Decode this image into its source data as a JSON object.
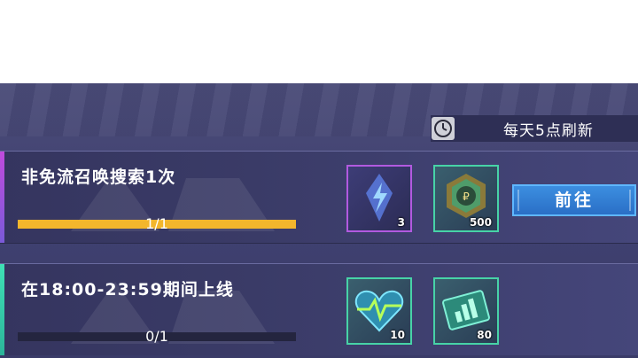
{
  "refresh": {
    "label": "每天5点刷新",
    "icon": "clock-icon"
  },
  "tasks": [
    {
      "title": "非免流召唤搜索1次",
      "progress_text": "1/1",
      "progress": 1.0,
      "accent": "#c04bdc",
      "rewards": [
        {
          "icon": "lightning-crystal-icon",
          "count": "3",
          "rarity_color": "#b25ae0"
        },
        {
          "icon": "coin-token-icon",
          "count": "500",
          "rarity_color": "#47d3a7"
        }
      ],
      "action_label": "前往"
    },
    {
      "title": "在18:00-23:59期间上线",
      "progress_text": "0/1",
      "progress": 0.0,
      "accent": "#3fe0b5",
      "rewards": [
        {
          "icon": "heart-pulse-icon",
          "count": "10",
          "rarity_color": "#47d3a7"
        },
        {
          "icon": "chart-card-icon",
          "count": "80",
          "rarity_color": "#47d3a7"
        }
      ]
    }
  ]
}
